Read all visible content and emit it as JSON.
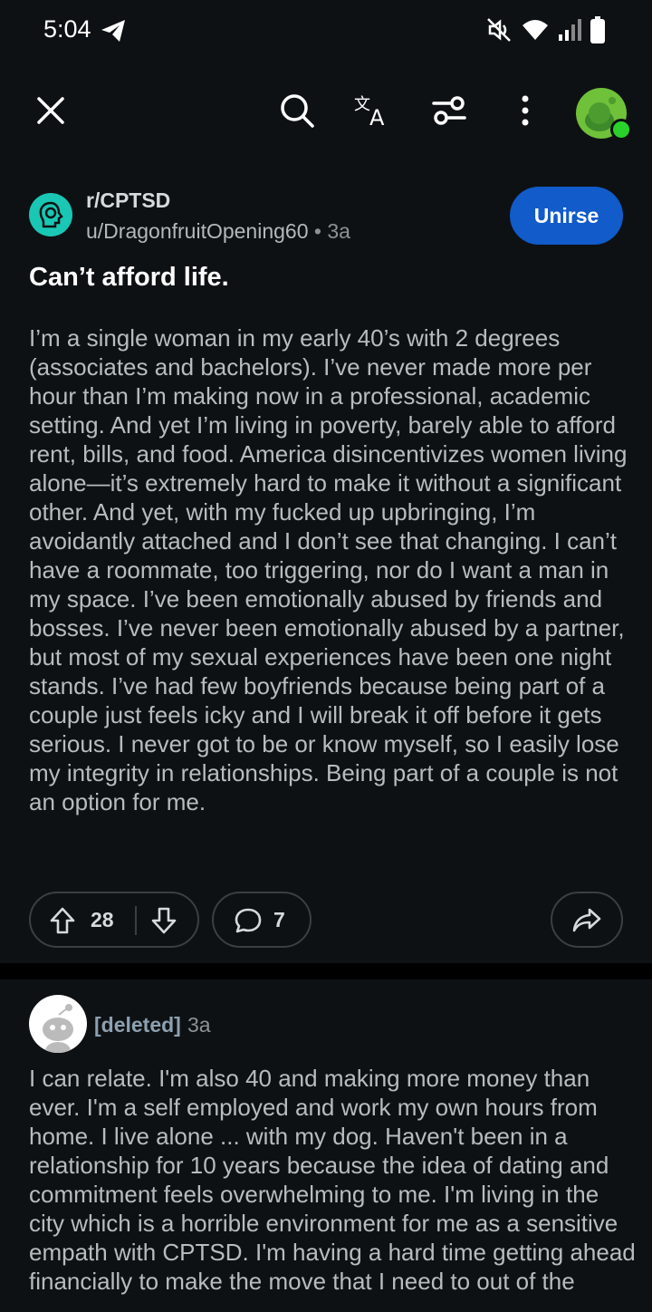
{
  "status_bar": {
    "time": "5:04"
  },
  "toolbar": {
    "close": "close-icon",
    "search": "search-icon",
    "translate": "translate-icon",
    "filters": "filter-icon",
    "more": "more-icon"
  },
  "post": {
    "subreddit": "r/CPTSD",
    "author": "u/DragonfruitOpening60",
    "separator": "•",
    "age": "3a",
    "join_label": "Unirse",
    "title": "Can’t afford life.",
    "body": "I’m a single woman in my early 40’s with 2 degrees (associates and bachelors). I’ve never made more per hour than I’m making now in a professional, academic setting. And yet I’m living in poverty, barely able to afford rent, bills, and food. America disincentivizes women living alone—it’s extremely hard to make it without a significant other. And yet, with my fucked up upbringing, I’m avoidantly attached and I don’t see that changing. I can’t have a roommate, too triggering, nor do I want a man in my space. I’ve been emotionally abused by friends and bosses. I’ve never been emotionally abused by a partner, but most of my sexual experiences have been one night stands. I’ve had few boyfriends because being part of a couple just feels icky and I will break it off before it gets serious. I never got to be or know myself, so I easily lose my integrity in relationships. Being part of a couple is not an option for me.",
    "votes": "28",
    "comments": "7"
  },
  "comment": {
    "author": "[deleted]",
    "age": "3a",
    "body": "I can relate. I'm also 40 and making more money than ever. I'm a self employed and work my own hours from home. I live alone ... with my dog. Haven't been in a relationship for 10 years because the idea of dating and commitment feels overwhelming to me. I'm living in the city which is a horrible environment for me as a sensitive empath with CPTSD. I'm having a hard time getting ahead financially to make the move that I need to out of the"
  },
  "colors": {
    "background": "#0e1113",
    "join_button": "#115bca",
    "subreddit_icon": "#19c7b4",
    "online_dot": "#2ad12a"
  }
}
